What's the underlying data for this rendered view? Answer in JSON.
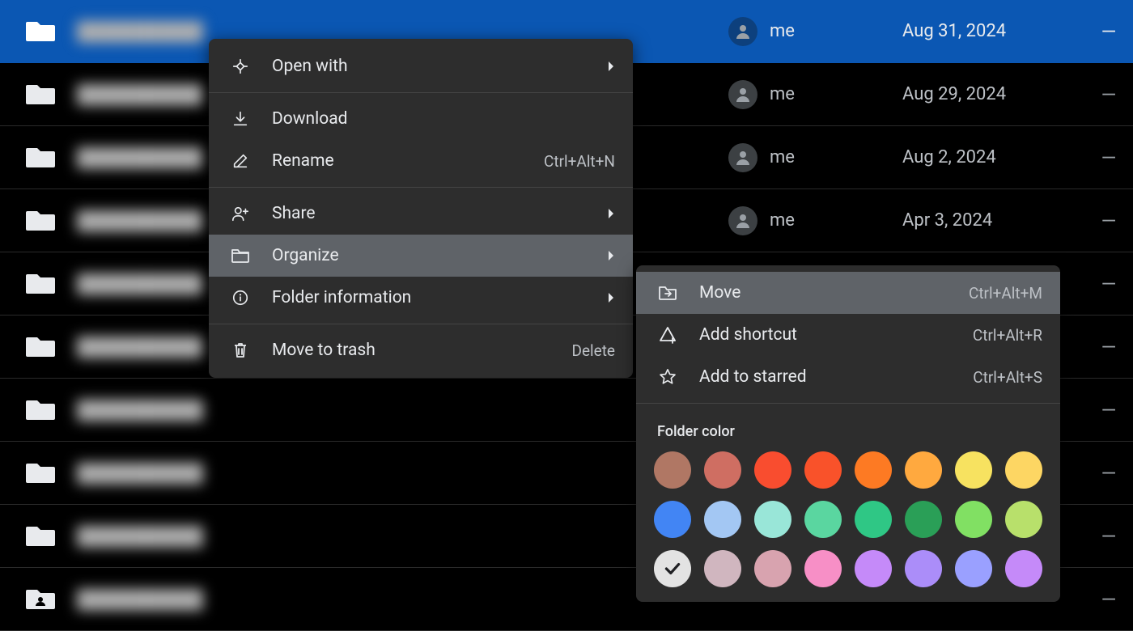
{
  "rows": [
    {
      "owner": "me",
      "date": "Aug 31, 2024",
      "selected": true,
      "shared": false
    },
    {
      "owner": "me",
      "date": "Aug 29, 2024",
      "selected": false,
      "shared": false
    },
    {
      "owner": "me",
      "date": "Aug 2, 2024",
      "selected": false,
      "shared": false
    },
    {
      "owner": "me",
      "date": "Apr 3, 2024",
      "selected": false,
      "shared": false
    },
    {
      "owner": "",
      "date": "",
      "selected": false,
      "shared": false
    },
    {
      "owner": "",
      "date": "",
      "selected": false,
      "shared": false
    },
    {
      "owner": "",
      "date": "",
      "selected": false,
      "shared": false
    },
    {
      "owner": "",
      "date": "",
      "selected": false,
      "shared": false
    },
    {
      "owner": "",
      "date": "",
      "selected": false,
      "shared": false
    },
    {
      "owner": "",
      "date": "",
      "selected": false,
      "shared": true
    }
  ],
  "menu": {
    "open_with": "Open with",
    "download": "Download",
    "rename": "Rename",
    "rename_sc": "Ctrl+Alt+N",
    "share": "Share",
    "organize": "Organize",
    "folder_info": "Folder information",
    "trash": "Move to trash",
    "trash_sc": "Delete"
  },
  "submenu": {
    "move": "Move",
    "move_sc": "Ctrl+Alt+M",
    "shortcut": "Add shortcut",
    "shortcut_sc": "Ctrl+Alt+R",
    "starred": "Add to starred",
    "starred_sc": "Ctrl+Alt+S",
    "folder_color_title": "Folder color"
  },
  "colors": [
    "#b07764",
    "#cf6e62",
    "#f94d2f",
    "#f9522a",
    "#fd7a23",
    "#ffa93f",
    "#f7e260",
    "#fdd663",
    "#4285f4",
    "#a3c7f3",
    "#99e6d8",
    "#5ad6a0",
    "#2fc785",
    "#2a9f57",
    "#81e063",
    "#b8e06b",
    "#e3e3e3",
    "#d0b6bf",
    "#d8a3af",
    "#f78fc6",
    "#c58af9",
    "#ab8df9",
    "#9aa0ff",
    "#c58af9"
  ],
  "selected_color_index": 16
}
